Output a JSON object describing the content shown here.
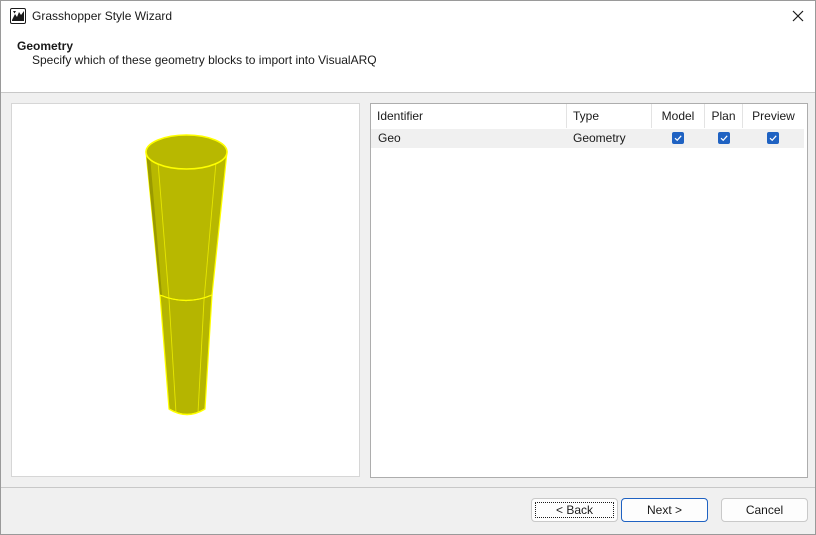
{
  "window": {
    "title": "Grasshopper Style Wizard"
  },
  "header": {
    "title": "Geometry",
    "subtitle": "Specify which of these geometry blocks to import into VisualARQ"
  },
  "table": {
    "columns": [
      "Identifier",
      "Type",
      "Model",
      "Plan",
      "Preview"
    ],
    "rows": [
      {
        "identifier": "Geo",
        "type": "Geometry",
        "model": true,
        "plan": true,
        "preview": true
      }
    ]
  },
  "buttons": {
    "back": "< Back",
    "next": "Next >",
    "cancel": "Cancel"
  },
  "colors": {
    "accent": "#1f62c2",
    "geometry_fill": "#b8b800",
    "geometry_edge": "#ffff00"
  }
}
